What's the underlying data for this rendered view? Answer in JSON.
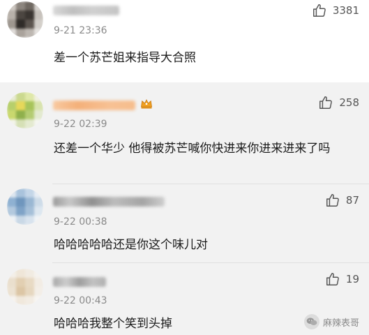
{
  "comments": [
    {
      "time": "9-21 23:36",
      "text": "差一个苏芒姐来指导大合照",
      "likes": "3381"
    },
    {
      "time": "9-22 02:39",
      "text": "还差一个华少 他得被苏芒喊你快进来你进来进来了吗",
      "likes": "258"
    },
    {
      "time": "9-22 00:38",
      "text": "哈哈哈哈哈还是你这个味儿对",
      "likes": "87"
    },
    {
      "time": "9-22 00:43",
      "text": "哈哈哈我整个笑到头掉",
      "likes": "19"
    }
  ],
  "watermark": {
    "text": "麻辣表哥",
    "icon": "wechat-icon"
  },
  "icons": {
    "like": "thumbs-up-icon",
    "vip": "crown-icon"
  },
  "colors": {
    "vip_crown": "#f0a020",
    "name_highlight": "#f4b07a"
  }
}
